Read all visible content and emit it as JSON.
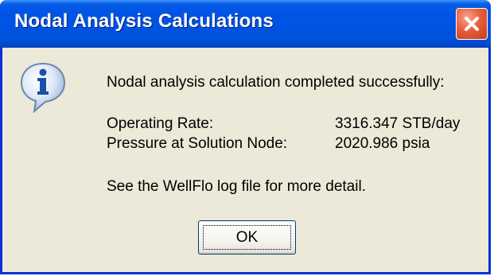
{
  "dialog": {
    "title": "Nodal Analysis Calculations",
    "icon": "info-icon",
    "message": "Nodal analysis calculation completed successfully:",
    "results": [
      {
        "label": "Operating Rate:",
        "value": "3316.347 STB/day"
      },
      {
        "label": "Pressure at Solution Node:",
        "value": "2020.986 psia"
      }
    ],
    "footer_note": "See the WellFlo log file for more detail.",
    "ok_label": "OK",
    "close_icon": "close-icon"
  },
  "colors": {
    "titlebar": "#0054e3",
    "frame": "#0831d9",
    "body": "#ece9d8",
    "close_button": "#e75f3a"
  }
}
